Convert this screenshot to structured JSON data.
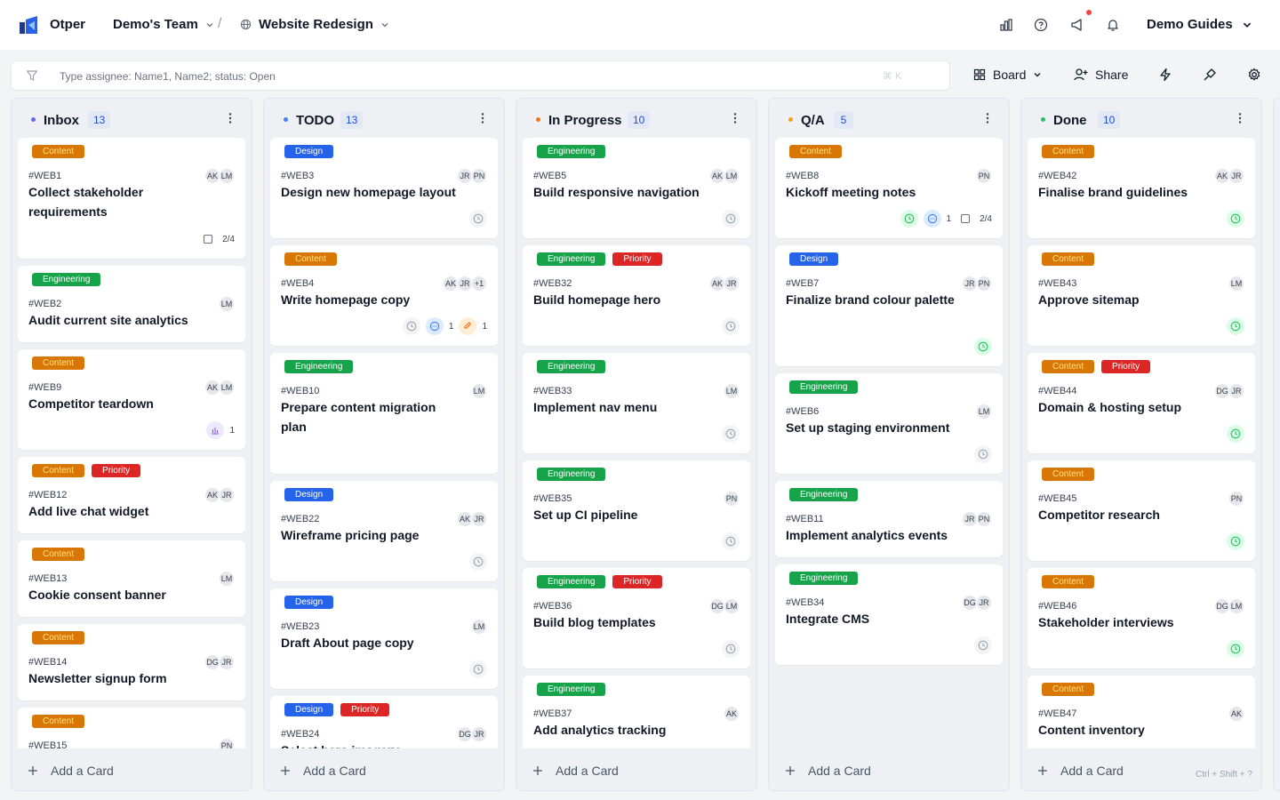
{
  "app": {
    "name": "Otper"
  },
  "breadcrumb": {
    "team": "Demo's Team",
    "separator": "/",
    "project": "Website Redesign"
  },
  "header": {
    "guides_label": "Demo Guides"
  },
  "filter": {
    "placeholder": "Type assignee: Name1, Name2; status: Open",
    "shortcut": "⌘ K"
  },
  "toolbar": {
    "view_label": "Board",
    "share_label": "Share"
  },
  "colors": {
    "content": "#d97706",
    "engineering": "#16a34a",
    "design": "#2563eb",
    "priority": "#dc2626",
    "accent": "#1d4ed8"
  },
  "columns": [
    {
      "title": "Inbox",
      "count": "13",
      "dot": "#6366f1",
      "add_label": "Add a Card"
    },
    {
      "title": "TODO",
      "count": "13",
      "dot": "#3b82f6",
      "add_label": "Add a Card"
    },
    {
      "title": "In Progress",
      "count": "10",
      "dot": "#f97316",
      "add_label": "Add a Card"
    },
    {
      "title": "Q/A",
      "count": "5",
      "dot": "#f59e0b",
      "add_label": "Add a Card"
    },
    {
      "title": "Done",
      "count": "10",
      "dot": "#22c55e",
      "add_label": "Add a Card"
    }
  ],
  "cards": [
    [
      {
        "tags": [
          "Content"
        ],
        "id": "#WEB1",
        "title": "Collect stakeholder requirements",
        "avatars": [
          "AK",
          "LM"
        ],
        "meta": [
          {
            "icon": "checkbox-icon",
            "style": "plain",
            "text": "2/4"
          }
        ]
      },
      {
        "tags": [
          "Engineering"
        ],
        "id": "#WEB2",
        "title": "Audit current site analytics",
        "avatars": [
          "LM"
        ],
        "meta": []
      },
      {
        "tags": [
          "Content"
        ],
        "id": "#WEB9",
        "title": "Competitor teardown",
        "avatars": [
          "AK",
          "LM"
        ],
        "meta": [
          {
            "icon": "chart-icon",
            "style": "purple",
            "text": "1"
          }
        ]
      },
      {
        "tags": [
          "Content",
          "Priority"
        ],
        "id": "#WEB12",
        "title": "Add live chat widget",
        "avatars": [
          "AK",
          "JR"
        ],
        "meta": []
      },
      {
        "tags": [
          "Content"
        ],
        "id": "#WEB13",
        "title": "Cookie consent banner",
        "avatars": [
          "LM"
        ],
        "meta": []
      },
      {
        "tags": [
          "Content"
        ],
        "id": "#WEB14",
        "title": "Newsletter signup form",
        "avatars": [
          "DG",
          "JR"
        ],
        "meta": []
      },
      {
        "tags": [
          "Content"
        ],
        "id": "#WEB15",
        "title": "",
        "avatars": [
          "PN"
        ],
        "meta": []
      }
    ],
    [
      {
        "tags": [
          "Design"
        ],
        "id": "#WEB3",
        "title": "Design new homepage layout",
        "avatars": [
          "JR",
          "PN"
        ],
        "meta": [
          {
            "icon": "clock-icon",
            "style": "grey",
            "text": ""
          }
        ]
      },
      {
        "tags": [
          "Content"
        ],
        "id": "#WEB4",
        "title": "Write homepage copy",
        "avatars": [
          "AK",
          "JR",
          "+1"
        ],
        "meta": [
          {
            "icon": "clock-icon",
            "style": "grey",
            "text": ""
          },
          {
            "icon": "comment-icon",
            "style": "blue",
            "text": "1"
          },
          {
            "icon": "attachment-icon",
            "style": "orange",
            "text": "1"
          }
        ]
      },
      {
        "tags": [
          "Engineering"
        ],
        "id": "#WEB10",
        "title": "Prepare content migration plan",
        "avatars": [
          "LM"
        ],
        "meta": []
      },
      {
        "tags": [
          "Design"
        ],
        "id": "#WEB22",
        "title": "Wireframe pricing page",
        "avatars": [
          "AK",
          "JR"
        ],
        "meta": [
          {
            "icon": "clock-icon",
            "style": "grey",
            "text": ""
          }
        ]
      },
      {
        "tags": [
          "Design"
        ],
        "id": "#WEB23",
        "title": "Draft About page copy",
        "avatars": [
          "LM"
        ],
        "meta": [
          {
            "icon": "clock-icon",
            "style": "grey",
            "text": ""
          }
        ]
      },
      {
        "tags": [
          "Design",
          "Priority"
        ],
        "id": "#WEB24",
        "title": "Select hero imagery",
        "avatars": [
          "DG",
          "JR"
        ],
        "meta": [
          {
            "icon": "clock-icon",
            "style": "grey",
            "text": ""
          }
        ]
      }
    ],
    [
      {
        "tags": [
          "Engineering"
        ],
        "id": "#WEB5",
        "title": "Build responsive navigation",
        "avatars": [
          "AK",
          "LM"
        ],
        "meta": [
          {
            "icon": "clock-icon",
            "style": "grey",
            "text": ""
          }
        ]
      },
      {
        "tags": [
          "Engineering",
          "Priority"
        ],
        "id": "#WEB32",
        "title": "Build homepage hero",
        "avatars": [
          "AK",
          "JR"
        ],
        "meta": [
          {
            "icon": "clock-icon",
            "style": "grey",
            "text": ""
          }
        ]
      },
      {
        "tags": [
          "Engineering"
        ],
        "id": "#WEB33",
        "title": "Implement nav menu",
        "avatars": [
          "LM"
        ],
        "meta": [
          {
            "icon": "clock-icon",
            "style": "grey",
            "text": ""
          }
        ]
      },
      {
        "tags": [
          "Engineering"
        ],
        "id": "#WEB35",
        "title": "Set up CI pipeline",
        "avatars": [
          "PN"
        ],
        "meta": [
          {
            "icon": "clock-icon",
            "style": "grey",
            "text": ""
          }
        ]
      },
      {
        "tags": [
          "Engineering",
          "Priority"
        ],
        "id": "#WEB36",
        "title": "Build blog templates",
        "avatars": [
          "DG",
          "LM"
        ],
        "meta": [
          {
            "icon": "clock-icon",
            "style": "grey",
            "text": ""
          }
        ]
      },
      {
        "tags": [
          "Engineering"
        ],
        "id": "#WEB37",
        "title": "Add analytics tracking",
        "avatars": [
          "AK"
        ],
        "meta": []
      }
    ],
    [
      {
        "tags": [
          "Content"
        ],
        "id": "#WEB8",
        "title": "Kickoff meeting notes",
        "avatars": [
          "PN"
        ],
        "meta": [
          {
            "icon": "clock-icon",
            "style": "green",
            "text": ""
          },
          {
            "icon": "comment-icon",
            "style": "blue",
            "text": "1"
          },
          {
            "icon": "checkbox-icon",
            "style": "plain",
            "text": "2/4"
          }
        ]
      },
      {
        "tags": [
          "Design"
        ],
        "id": "#WEB7",
        "title": "Finalize brand colour palette",
        "avatars": [
          "JR",
          "PN"
        ],
        "meta": [
          {
            "icon": "clock-icon",
            "style": "green",
            "text": ""
          }
        ]
      },
      {
        "tags": [
          "Engineering"
        ],
        "id": "#WEB6",
        "title": "Set up staging environment",
        "avatars": [
          "LM"
        ],
        "meta": [
          {
            "icon": "clock-icon",
            "style": "grey",
            "text": ""
          }
        ]
      },
      {
        "tags": [
          "Engineering"
        ],
        "id": "#WEB11",
        "title": "Implement analytics events",
        "avatars": [
          "JR",
          "PN"
        ],
        "meta": []
      },
      {
        "tags": [
          "Engineering"
        ],
        "id": "#WEB34",
        "title": "Integrate CMS",
        "avatars": [
          "DG",
          "JR"
        ],
        "meta": [
          {
            "icon": "clock-icon",
            "style": "grey",
            "text": ""
          }
        ]
      }
    ],
    [
      {
        "tags": [
          "Content"
        ],
        "id": "#WEB42",
        "title": "Finalise brand guidelines",
        "avatars": [
          "AK",
          "JR"
        ],
        "meta": [
          {
            "icon": "clock-icon",
            "style": "green",
            "text": ""
          }
        ]
      },
      {
        "tags": [
          "Content"
        ],
        "id": "#WEB43",
        "title": "Approve sitemap",
        "avatars": [
          "LM"
        ],
        "meta": [
          {
            "icon": "clock-icon",
            "style": "green",
            "text": ""
          }
        ]
      },
      {
        "tags": [
          "Content",
          "Priority"
        ],
        "id": "#WEB44",
        "title": "Domain & hosting setup",
        "avatars": [
          "DG",
          "JR"
        ],
        "meta": [
          {
            "icon": "clock-icon",
            "style": "green",
            "text": ""
          }
        ]
      },
      {
        "tags": [
          "Content"
        ],
        "id": "#WEB45",
        "title": "Competitor research",
        "avatars": [
          "PN"
        ],
        "meta": [
          {
            "icon": "clock-icon",
            "style": "green",
            "text": ""
          }
        ]
      },
      {
        "tags": [
          "Content"
        ],
        "id": "#WEB46",
        "title": "Stakeholder interviews",
        "avatars": [
          "DG",
          "LM"
        ],
        "meta": [
          {
            "icon": "clock-icon",
            "style": "green",
            "text": ""
          }
        ]
      },
      {
        "tags": [
          "Content"
        ],
        "id": "#WEB47",
        "title": "Content inventory",
        "avatars": [
          "AK"
        ],
        "meta": []
      }
    ]
  ],
  "footer": {
    "shortcut_hint": "Ctrl + Shift + ?"
  }
}
